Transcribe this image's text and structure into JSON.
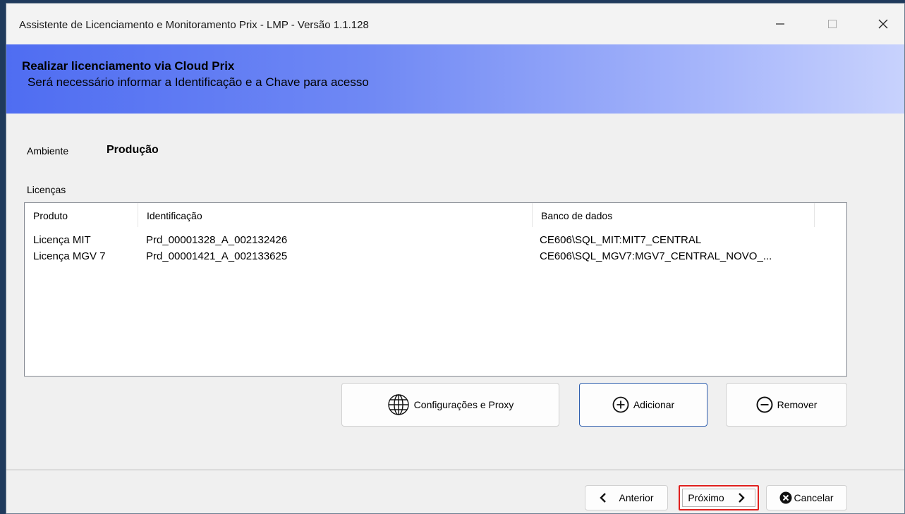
{
  "window": {
    "title": "Assistente de Licenciamento e Monitoramento Prix - LMP - Versão 1.1.128"
  },
  "header": {
    "title": "Realizar licenciamento via Cloud Prix",
    "subtitle": "Será necessário informar a Identificação e a Chave para acesso"
  },
  "ambiente": {
    "label": "Ambiente",
    "value": "Produção"
  },
  "licencas": {
    "label": "Licenças",
    "columns": [
      "Produto",
      "Identificação",
      "Banco de dados"
    ],
    "rows": [
      {
        "produto": "Licença MIT",
        "identificacao": "Prd_00001328_A_002132426",
        "banco": "CE606\\SQL_MIT:MIT7_CENTRAL"
      },
      {
        "produto": "Licença MGV 7",
        "identificacao": "Prd_00001421_A_002133625",
        "banco": "CE606\\SQL_MGV7:MGV7_CENTRAL_NOVO_..."
      }
    ]
  },
  "actions": {
    "config_label": "Configurações e Proxy",
    "add_label": "Adicionar",
    "remove_label": "Remover"
  },
  "footer": {
    "prev_label": "Anterior",
    "next_label": "Próximo",
    "cancel_label": "Cancelar"
  },
  "icons": {
    "globe": "globe-icon",
    "add": "plus-circle-icon",
    "remove": "minus-circle-icon",
    "prev": "chevron-left-icon",
    "next": "chevron-right-icon",
    "cancel": "x-circle-icon"
  },
  "colors": {
    "header_gradient_start": "#4f6df2",
    "header_gradient_end": "#c8d2fd",
    "focus_border": "#2f5fae",
    "highlight_red": "#e0201e"
  }
}
